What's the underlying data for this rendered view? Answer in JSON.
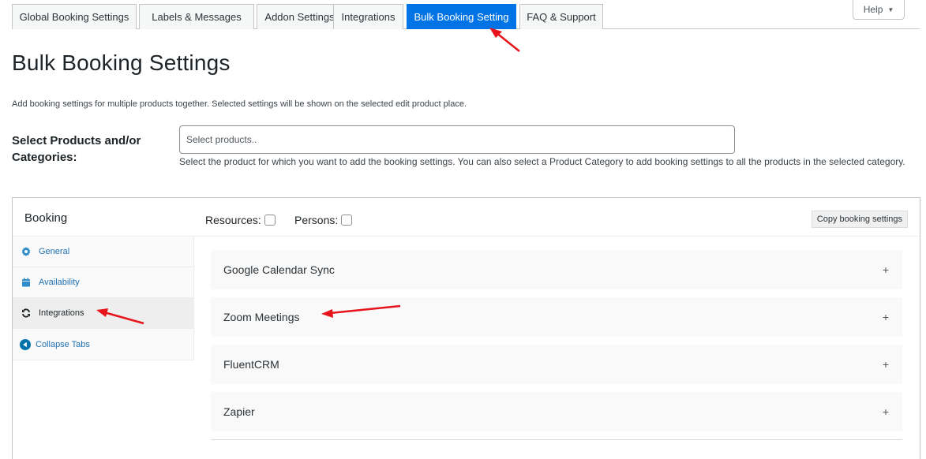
{
  "tabs": [
    {
      "label": "Global Booking Settings",
      "active": false
    },
    {
      "label": "Labels & Messages",
      "active": false
    },
    {
      "label": "Addon Settings",
      "active": false
    },
    {
      "label": "Integrations",
      "active": false
    },
    {
      "label": "Bulk Booking Setting",
      "active": true
    },
    {
      "label": "FAQ & Support",
      "active": false
    }
  ],
  "help": {
    "label": "Help",
    "icon": "caret-down-icon"
  },
  "page": {
    "title": "Bulk Booking Settings",
    "description": "Add booking settings for multiple products together. Selected settings will be shown on the selected edit product place."
  },
  "product_field": {
    "label": "Select Products and/or Categories:",
    "placeholder": "Select products..",
    "value": "",
    "help": "Select the product for which you want to add the booking settings. You can also select a Product Category to add booking settings to all the products in the selected category."
  },
  "booking": {
    "title": "Booking",
    "resources_label": "Resources:",
    "resources_checked": false,
    "persons_label": "Persons:",
    "persons_checked": false,
    "copy_button": "Copy booking settings",
    "side_tabs": [
      {
        "label": "General",
        "icon": "gear-icon",
        "active": false
      },
      {
        "label": "Availability",
        "icon": "calendar-icon",
        "active": false
      },
      {
        "label": "Integrations",
        "icon": "sync-icon",
        "active": true
      },
      {
        "label": "Collapse Tabs",
        "icon": "collapse-left-icon",
        "active": false
      }
    ],
    "panels": [
      {
        "title": "Google Calendar Sync",
        "toggle": "+"
      },
      {
        "title": "Zoom Meetings",
        "toggle": "+"
      },
      {
        "title": "FluentCRM",
        "toggle": "+"
      },
      {
        "title": "Zapier",
        "toggle": "+"
      }
    ]
  },
  "colors": {
    "accent": "#0073e6",
    "link": "#2271b1",
    "annotation_arrow": "#e8141b"
  }
}
